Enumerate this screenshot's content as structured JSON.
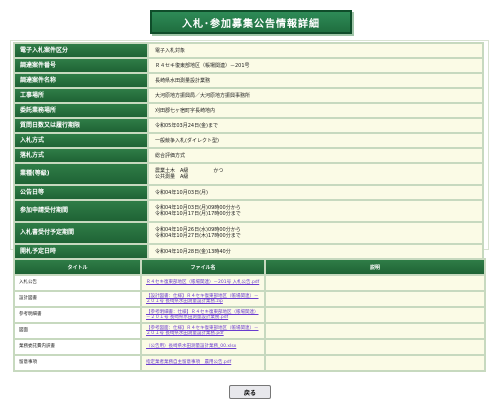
{
  "page": {
    "title": "入札･参加募集公告情報詳細"
  },
  "details": [
    {
      "label": "電子入札案件区分",
      "value": "電子入札対象"
    },
    {
      "label": "調達案件番号",
      "value": "Ｒ４セキ復東部地区（帳場関連）－201号"
    },
    {
      "label": "調達案件名称",
      "value": "長崎県水田測量設計業務"
    },
    {
      "label": "工事場所",
      "value": "大河原地方振興局／大河原地方振興事務所"
    },
    {
      "label": "委託業務場所",
      "value": "刈田郡七ヶ宿町字長崎地内"
    },
    {
      "label": "入札方式",
      "value": "一般競争入札(ダイレクト型)"
    },
    {
      "label": "落札方式",
      "value": "総合評価方式"
    },
    {
      "label": "業種(等級)",
      "value": "農業土木　A級　　　　　かつ\n公共測量　A級"
    },
    {
      "label": "公告日等",
      "value": "令和04年10月03日(月)"
    },
    {
      "label": "参加申請受付期間",
      "value": "令和04年10月03日(月)09時00分から\n令和04年10月17日(月)17時00分まで"
    },
    {
      "label": "入札書受付予定期間",
      "value": "令和04年10月26日(水)09時00分から\n令和04年10月27日(木)17時00分まで"
    },
    {
      "label": "開札予定日時",
      "value": "令和04年10月28日(金)13時40分"
    }
  ],
  "deadline_row": {
    "label": "質問日数又は履行期限",
    "value": "令和05年03月24日(金)まで"
  },
  "files": {
    "headers": [
      "タイトル",
      "ファイル名",
      "説明"
    ],
    "rows": [
      {
        "title": "入札公告",
        "file": "Ｒ４セキ復東部地区（帳場関連）－201号 入札公告.pdf",
        "desc": ""
      },
      {
        "title": "設計図書",
        "file": "【設計図書：仕様】Ｒ４セキ復東部地区（帳場関連）－２０１号 長崎県水田測量設計業務.zip",
        "desc": ""
      },
      {
        "title": "参考明細書",
        "file": "【参考明細書：仕様】Ｒ４セキ復東部地区（帳場関連）－２０１号 長崎県水田測量設計業務.pdf",
        "desc": ""
      },
      {
        "title": "図面",
        "file": "【参考図面：仕様】Ｒ４セキ復東部地区（帳場関連）－２０１号 長崎県水田測量設計業務.pdf",
        "desc": ""
      },
      {
        "title": "業務委託費内訳書",
        "file": "（公告用）長崎県水田測量設計業務_00.xlsx",
        "desc": ""
      },
      {
        "title": "留意事項",
        "file": "指定業者業務自主留意事項　農用公告.pdf",
        "desc": ""
      }
    ]
  },
  "buttons": {
    "back": "戻る"
  }
}
